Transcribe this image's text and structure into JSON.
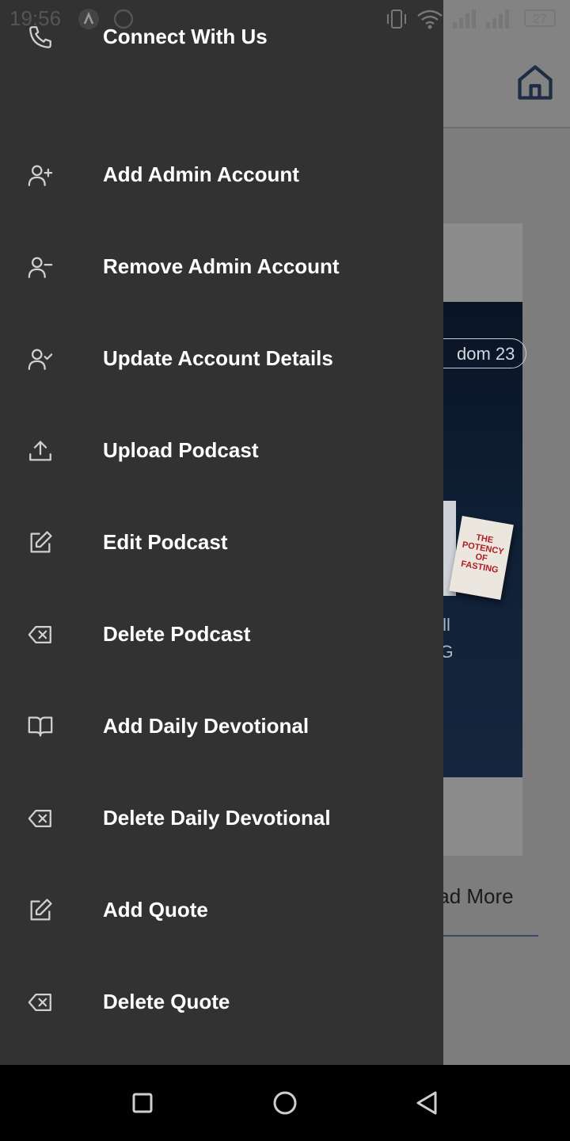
{
  "status_bar": {
    "time": "19:56",
    "battery": "27"
  },
  "drawer": {
    "items": [
      {
        "label": "Connect With Us",
        "icon": "phone-icon"
      },
      {
        "label": "Add Admin Account",
        "icon": "user-plus-icon"
      },
      {
        "label": "Remove Admin Account",
        "icon": "user-minus-icon"
      },
      {
        "label": "Update Account Details",
        "icon": "user-check-icon"
      },
      {
        "label": "Upload Podcast",
        "icon": "upload-icon"
      },
      {
        "label": "Edit Podcast",
        "icon": "edit-icon"
      },
      {
        "label": "Delete Podcast",
        "icon": "delete-icon"
      },
      {
        "label": "Add Daily Devotional",
        "icon": "book-open-icon"
      },
      {
        "label": "Delete Daily Devotional",
        "icon": "delete-icon"
      },
      {
        "label": "Add Quote",
        "icon": "edit-icon"
      },
      {
        "label": "Delete Quote",
        "icon": "delete-icon"
      }
    ]
  },
  "background": {
    "pill_text": "dom 23",
    "book_title": "THE POTENCY OF FASTING",
    "image_text_line1": "d will",
    "image_text_line2": "TING",
    "read_more": "Read More"
  },
  "colors": {
    "drawer_bg": "#323232",
    "scrim": "#808080",
    "nav_bg": "#000000",
    "text": "#ffffff"
  }
}
